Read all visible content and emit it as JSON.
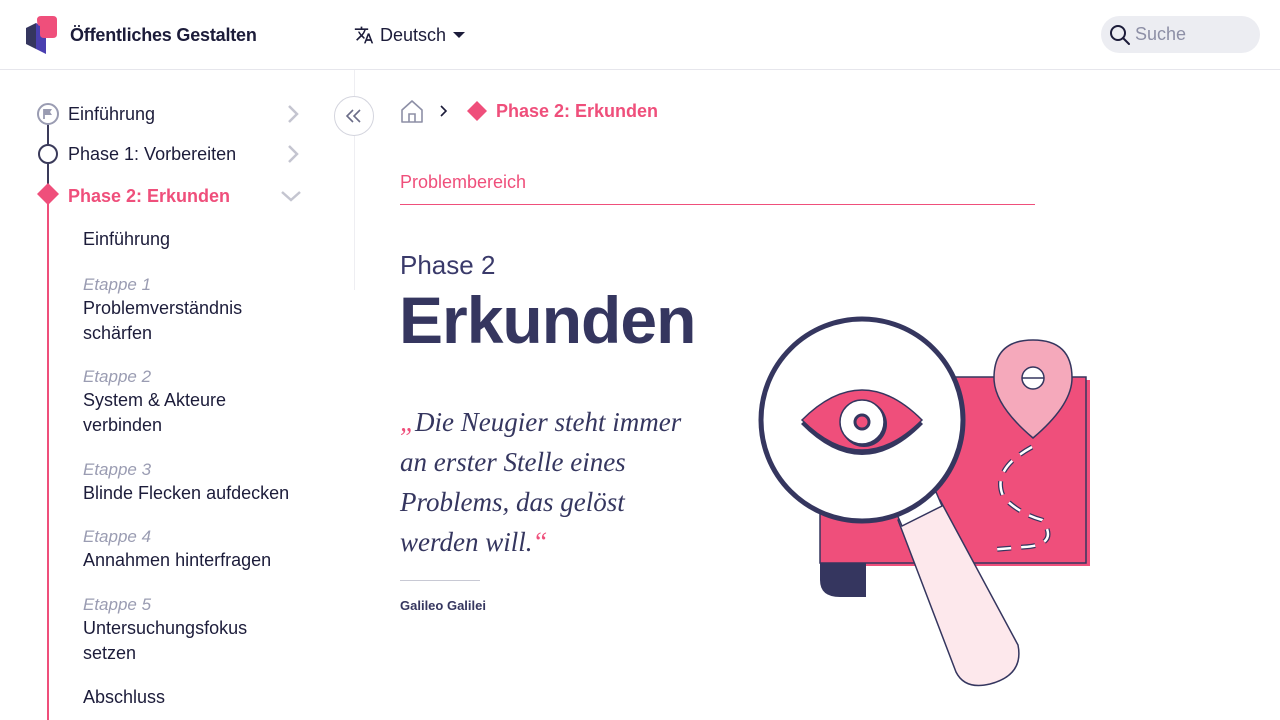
{
  "header": {
    "brand": "Öffentliches Gestalten",
    "language": "Deutsch",
    "search_placeholder": "Suche"
  },
  "sidebar": {
    "phases": [
      {
        "label": "Einführung",
        "state": "done"
      },
      {
        "label": "Phase 1: Vorbereiten",
        "state": "done"
      },
      {
        "label": "Phase 2: Erkunden",
        "state": "active"
      }
    ],
    "items": [
      {
        "step": "",
        "title": "Einführung"
      },
      {
        "step": "Etappe 1",
        "title": "Problemverständnis schärfen"
      },
      {
        "step": "Etappe 2",
        "title": "System & Akteure verbinden"
      },
      {
        "step": "Etappe 3",
        "title": "Blinde Flecken aufdecken"
      },
      {
        "step": "Etappe 4",
        "title": "Annahmen hinterfragen"
      },
      {
        "step": "Etappe 5",
        "title": "Untersuchungsfokus setzen"
      },
      {
        "step": "",
        "title": "Abschluss"
      }
    ]
  },
  "breadcrumb": {
    "current": "Phase 2: Erkunden"
  },
  "main": {
    "section_label": "Problembereich",
    "phase_subtitle": "Phase 2",
    "phase_title": "Erkunden",
    "quote_open": "„",
    "quote_text": "Die Neugier steht immer an erster Stelle eines Problems, das gelöst werden will.",
    "quote_close": "“",
    "quote_author": "Galileo Galilei"
  },
  "colors": {
    "accent": "#ef4f7b",
    "navy": "#35365f"
  }
}
